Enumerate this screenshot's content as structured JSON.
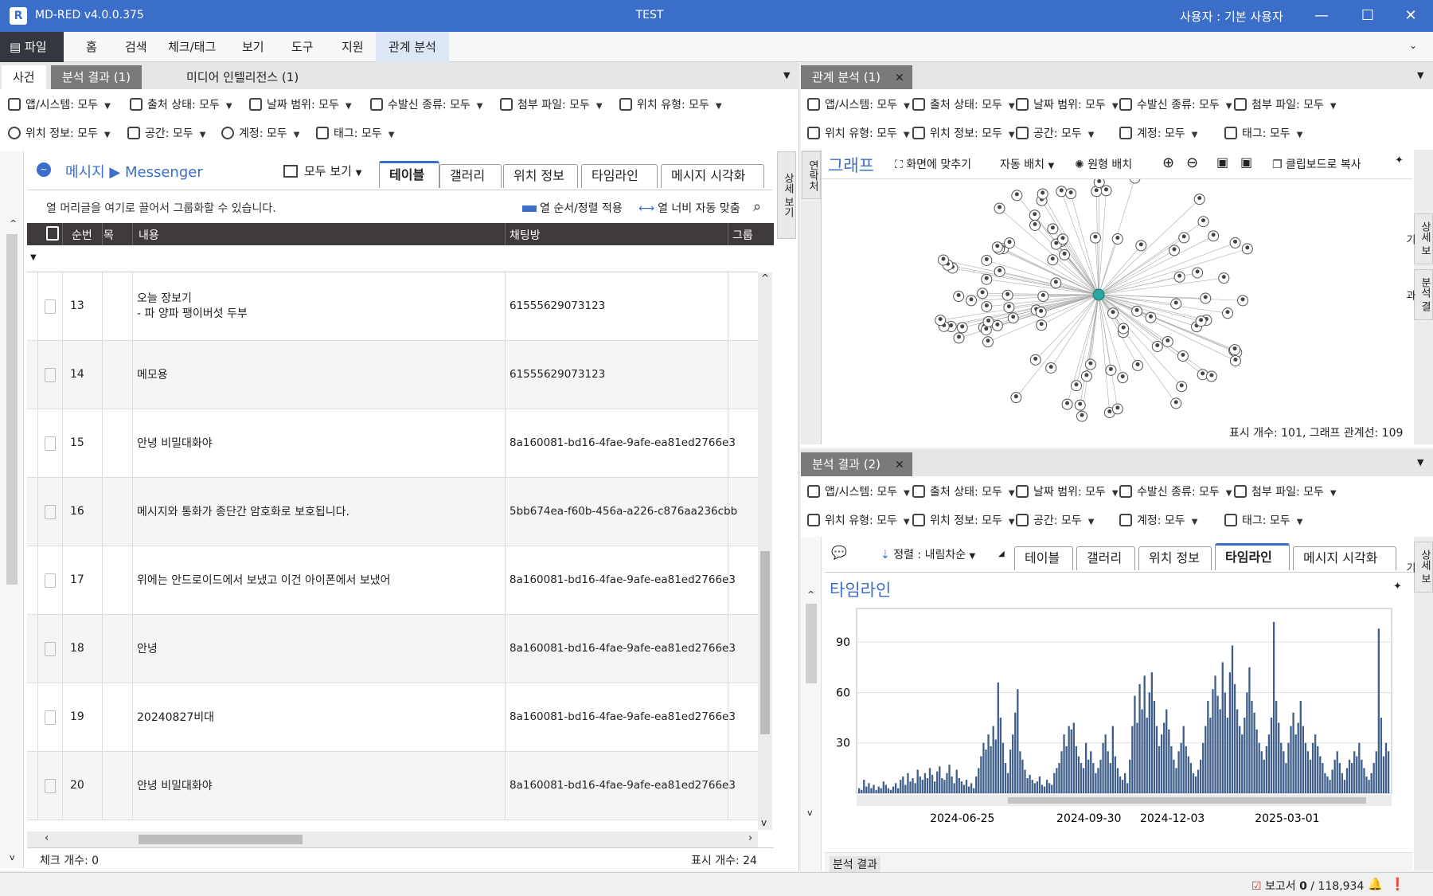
{
  "app": {
    "title": "MD-RED v4.0.0.375",
    "doc": "TEST",
    "user": "사용자 : 기본 사용자",
    "logo": "R"
  },
  "window": {
    "min": "—",
    "max": "☐",
    "close": "✕"
  },
  "menu": [
    "▤ 파일",
    "홈",
    "검색",
    "체크/태그",
    "보기",
    "도구",
    "지원",
    "관계 분석"
  ],
  "left": {
    "tabs": [
      "사건",
      "분석 결과 (1)",
      "미디어 인텔리전스 (1)"
    ],
    "filters1": [
      "앱/시스템: 모두",
      "출처 상태: 모두",
      "날짜 범위: 모두",
      "수발신 종류: 모두",
      "첨부 파일: 모두",
      "위치 유형: 모두"
    ],
    "filters2": [
      "위치 정보: 모두",
      "공간: 모두",
      "계정: 모두",
      "태그: 모두"
    ],
    "breadcrumb": {
      "a": "메시지",
      "b": "Messenger"
    },
    "viewall": "모두 보기",
    "subtabs": [
      "테이블",
      "갤러리",
      "위치 정보",
      "타임라인",
      "메시지 시각화"
    ],
    "grouphint": "열 머리글을 여기로 끌어서 그룹화할 수 있습니다.",
    "colorder": "열 순서/정렬 적용",
    "colwidth": "열 너비 자동 맞춤",
    "columns": [
      "순번",
      "목",
      "내용",
      "채팅방",
      "그룹"
    ],
    "rows": [
      {
        "n": "13",
        "content": "오늘 장보기\n- 파 양파 팽이버섯 두부",
        "room": "61555629073123"
      },
      {
        "n": "14",
        "content": "메모용",
        "room": "61555629073123"
      },
      {
        "n": "15",
        "content": "안녕 비밀대화야",
        "room": "8a160081-bd16-4fae-9afe-ea81ed2766e3"
      },
      {
        "n": "16",
        "content": "메시지와 통화가 종단간 암호화로 보호됩니다.",
        "room": "5bb674ea-f60b-456a-a226-c876aa236cbb"
      },
      {
        "n": "17",
        "content": "위에는 안드로이드에서 보냈고 이건 아이폰에서 보냈어",
        "room": "8a160081-bd16-4fae-9afe-ea81ed2766e3"
      },
      {
        "n": "18",
        "content": "안녕",
        "room": "8a160081-bd16-4fae-9afe-ea81ed2766e3"
      },
      {
        "n": "19",
        "content": "20240827비대",
        "room": "8a160081-bd16-4fae-9afe-ea81ed2766e3"
      },
      {
        "n": "20",
        "content": "안녕 비밀대화야",
        "room": "8a160081-bd16-4fae-9afe-ea81ed2766e3"
      }
    ],
    "checkcount": "체크 개수: 0",
    "showcount": "표시 개수: 24",
    "sidetab": "상세 보기"
  },
  "graph": {
    "tab": "관계 분석 (1)",
    "filters1": [
      "앱/시스템: 모두",
      "출처 상태: 모두",
      "날짜 범위: 모두",
      "수발신 종류: 모두",
      "첨부 파일: 모두"
    ],
    "filters2": [
      "위치 유형: 모두",
      "위치 정보: 모두",
      "공간: 모두",
      "계정: 모두",
      "태그: 모두"
    ],
    "title": "그래프",
    "fit": "화면에 맞추기",
    "auto": "자동 배치",
    "circle": "원형 배치",
    "copy": "클립보드로 복사",
    "sidelabel": "연락처",
    "status": "표시 개수: 101, 그래프 관계선: 109",
    "side1": "상세 보기",
    "side2": "분석 결과"
  },
  "result2": {
    "tab": "분석 결과 (2)",
    "filters1": [
      "앱/시스템: 모두",
      "출처 상태: 모두",
      "날짜 범위: 모두",
      "수발신 종류: 모두",
      "첨부 파일: 모두"
    ],
    "filters2": [
      "위치 유형: 모두",
      "위치 정보: 모두",
      "공간: 모두",
      "계정: 모두",
      "태그: 모두"
    ],
    "sort": "정렬 : 내림차순",
    "subtabs": [
      "테이블",
      "갤러리",
      "위치 정보",
      "타임라인",
      "메시지 시각화"
    ],
    "timeline_title": "타임라인",
    "bottom": "분석 결과",
    "side": "상세 보기"
  },
  "chart_data": {
    "type": "bar",
    "title": "타임라인",
    "yticks": [
      30,
      60,
      90
    ],
    "ylim": [
      0,
      110
    ],
    "xtick_labels": [
      "2024-06-25",
      "2024-09-30",
      "2024-12-03",
      "2025-03-01"
    ],
    "x_start": "2024-04-05",
    "x_end": "2025-05-20",
    "series": [
      {
        "values": [
          3,
          2,
          8,
          4,
          6,
          3,
          5,
          2,
          4,
          3,
          7,
          5,
          3,
          2,
          4,
          6,
          3,
          8,
          10,
          5,
          12,
          7,
          9,
          6,
          14,
          10,
          8,
          12,
          9,
          15,
          11,
          7,
          13,
          16,
          9,
          8,
          12,
          17,
          10,
          6,
          14,
          9,
          7,
          5,
          8,
          4,
          6,
          3,
          10,
          15,
          22,
          30,
          26,
          35,
          28,
          40,
          32,
          66,
          45,
          30,
          18,
          12,
          26,
          35,
          48,
          62,
          25,
          20,
          14,
          9,
          11,
          8,
          6,
          7,
          10,
          5,
          4,
          8,
          6,
          5,
          12,
          15,
          18,
          25,
          35,
          28,
          40,
          38,
          42,
          28,
          22,
          18,
          15,
          30,
          20,
          25,
          18,
          12,
          15,
          20,
          30,
          35,
          25,
          18,
          40,
          22,
          15,
          10,
          8,
          12,
          6,
          20,
          40,
          58,
          42,
          65,
          50,
          70,
          45,
          60,
          72,
          55,
          40,
          28,
          35,
          42,
          50,
          38,
          28,
          20,
          15,
          25,
          30,
          40,
          28,
          22,
          18,
          12,
          10,
          14,
          20,
          30,
          40,
          55,
          45,
          62,
          70,
          58,
          50,
          78,
          60,
          45,
          72,
          88,
          65,
          50,
          40,
          35,
          45,
          60,
          75,
          55,
          48,
          38,
          30,
          25,
          20,
          28,
          35,
          45,
          102,
          55,
          42,
          30,
          25,
          18,
          30,
          40,
          48,
          35,
          42,
          55,
          40,
          30,
          25,
          20,
          30,
          35,
          28,
          22,
          18,
          12,
          10,
          8,
          14,
          20,
          25,
          18,
          12,
          8,
          15,
          20,
          18,
          25,
          22,
          30,
          20,
          15,
          10,
          8,
          12,
          18,
          25,
          98,
          45,
          22,
          30,
          25
        ]
      }
    ]
  }
}
